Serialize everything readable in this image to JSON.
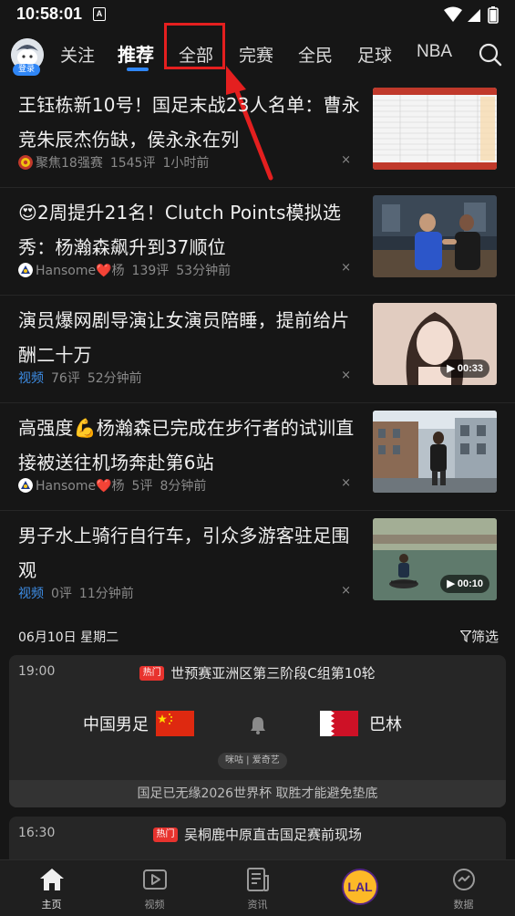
{
  "status_bar": {
    "time": "10:58:01",
    "notif_letter": "A"
  },
  "top_nav": {
    "login_label": "登录",
    "tabs": [
      {
        "label": "关注"
      },
      {
        "label": "推荐"
      },
      {
        "label": "全部"
      },
      {
        "label": "完赛"
      },
      {
        "label": "全民"
      },
      {
        "label": "足球"
      },
      {
        "label": "NBA"
      }
    ]
  },
  "news": [
    {
      "title": "王钰栋新10号！国足末战23人名单：曹永竞朱辰杰伤缺，侯永永在列",
      "source": "聚焦18强赛",
      "comments": "1545评",
      "time": "1小时前",
      "close": "×"
    },
    {
      "title": "😍2周提升21名！Clutch Points模拟选秀：杨瀚森飙升到37顺位",
      "source": "Hansome❤️杨",
      "comments": "139评",
      "time": "53分钟前",
      "close": "×"
    },
    {
      "title": "演员爆网剧导演让女演员陪睡，提前给片酬二十万",
      "source": "视频",
      "comments": "76评",
      "time": "52分钟前",
      "close": "×",
      "duration": "00:33"
    },
    {
      "title": "高强度💪杨瀚森已完成在步行者的试训直接被送往机场奔赴第6站",
      "source": "Hansome❤️杨",
      "comments": "5评",
      "time": "8分钟前",
      "close": "×"
    },
    {
      "title": "男子水上骑行自行车，引众多游客驻足围观",
      "source": "视频",
      "comments": "0评",
      "time": "11分钟前",
      "close": "×",
      "duration": "00:10"
    }
  ],
  "schedule": {
    "date": "06月10日 星期二",
    "filter_label": "筛选",
    "match": {
      "time": "19:00",
      "hot_tag": "热门",
      "title": "世预赛亚洲区第三阶段C组第10轮",
      "home_team": "中国男足",
      "away_team": "巴林",
      "providers": "咪咕 | 爱奇艺",
      "note": "国足已无缘2026世界杯 取胜才能避免垫底"
    },
    "match2": {
      "time": "16:30",
      "hot_tag": "热门",
      "title": "吴桐鹿中原直击国足赛前现场"
    }
  },
  "bottom_nav": [
    {
      "label": "主页"
    },
    {
      "label": "视频"
    },
    {
      "label": "资讯"
    },
    {
      "label": "LAL"
    },
    {
      "label": "数据"
    }
  ],
  "colors": {
    "accent": "#2f86f6",
    "highlight": "#e41f1f",
    "hot": "#e8332e",
    "background": "#161616"
  }
}
